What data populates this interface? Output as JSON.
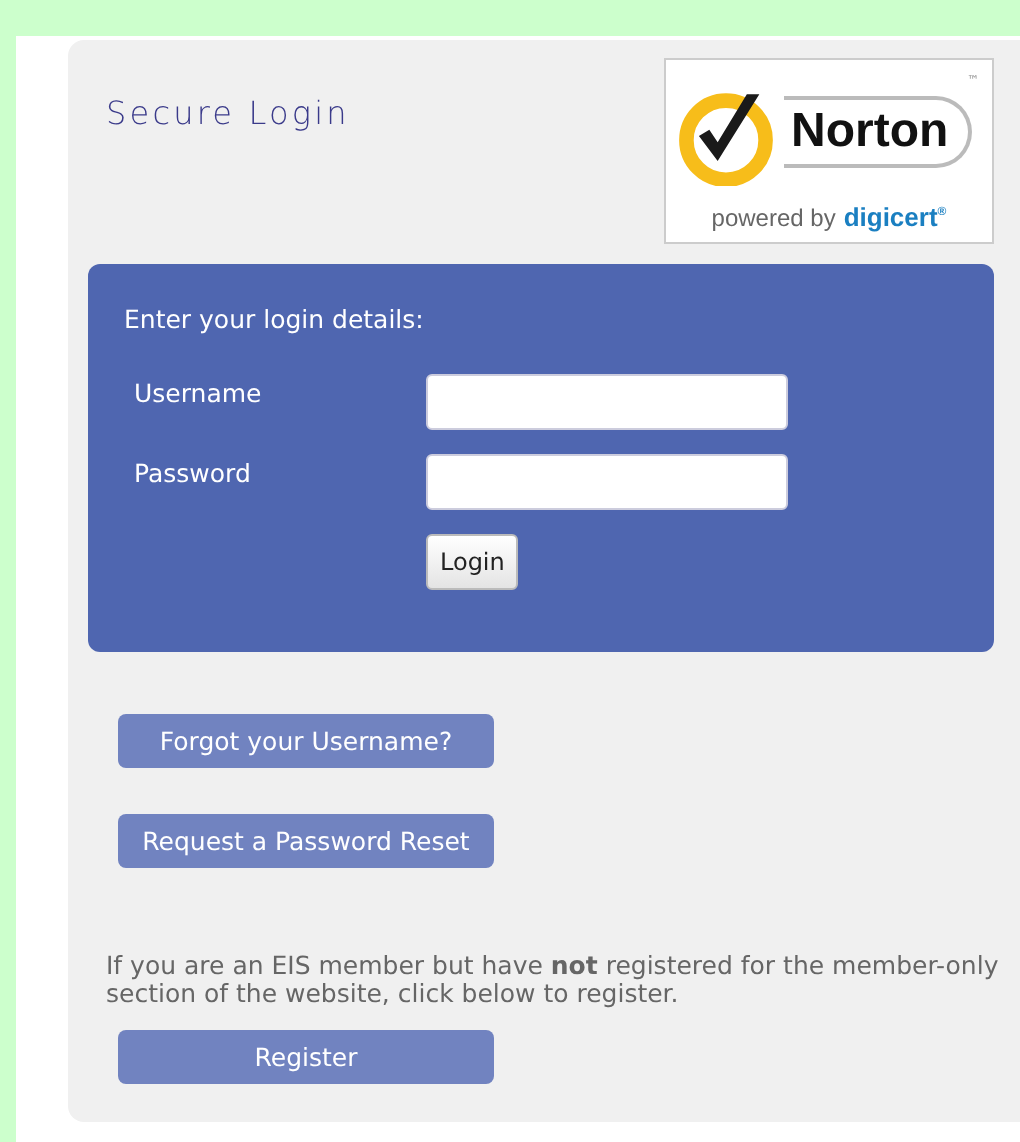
{
  "title": "Secure Login",
  "badge": {
    "brand": "Norton",
    "trademark": "™",
    "tagline": "powered by",
    "partner": "digicert",
    "partner_mark": "®"
  },
  "login_panel": {
    "heading": "Enter your login details:",
    "fields": [
      {
        "label": "Username"
      },
      {
        "label": "Password"
      }
    ],
    "submit": "Login"
  },
  "links": [
    "Forgot your Username?",
    "Request a Password Reset"
  ],
  "register_note": "If you are an EIS member but have **not** registered for the member-only section of the website, click below to register.",
  "register_button": "Register"
}
